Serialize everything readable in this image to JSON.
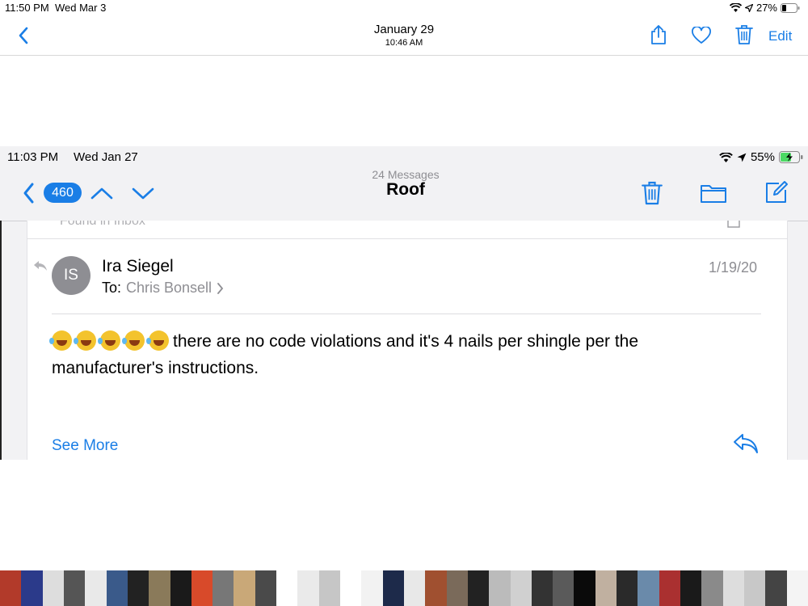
{
  "outer_status": {
    "time": "11:50 PM",
    "date": "Wed Mar 3",
    "battery": "27%"
  },
  "outer_nav": {
    "date_title": "January 29",
    "time_sub": "10:46 AM",
    "edit_label": "Edit"
  },
  "inner_status": {
    "time": "11:03 PM",
    "date": "Wed Jan 27",
    "battery": "55%"
  },
  "inner_nav": {
    "badge_count": "460",
    "message_count": "24 Messages",
    "title": "Roof"
  },
  "email": {
    "found_label": "Found in Inbox",
    "avatar_initials": "IS",
    "sender": "Ira Siegel",
    "to_label": "To:",
    "recipient": "Chris Bonsell",
    "date": "1/19/20",
    "body_line1": "there are no code violations and it's 4 nails per shingle per the",
    "body_line2": "manufacturer's instructions.",
    "see_more": "See More"
  },
  "colors": {
    "accent": "#1a7ee6",
    "battery_green": "#4cd964"
  },
  "thumbnail_colors": [
    "#b23a2a",
    "#2b3a8a",
    "#ddd",
    "#555",
    "#e9e9e9",
    "#3a5a8a",
    "#222",
    "#8a7a5a",
    "#1a1a1a",
    "#d84a2a",
    "#777",
    "#c9a878",
    "#4a4a4a",
    "#ffffff",
    "#eaeaea",
    "#c6c6c6",
    "#ffffff",
    "#f2f2f2",
    "#1d2a4a",
    "#e8e8e8",
    "#a05030",
    "#7a6a5a",
    "#222",
    "#bbb",
    "#d0d0d0",
    "#333",
    "#5a5a5a",
    "#0a0a0a",
    "#c0b0a0",
    "#2a2a2a",
    "#6a8aaa",
    "#aa3030",
    "#1a1a1a",
    "#8a8a8a",
    "#ddd",
    "#c8c8c8",
    "#444",
    "#f4f4f4"
  ]
}
